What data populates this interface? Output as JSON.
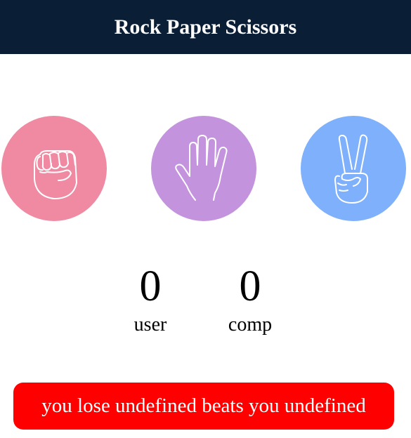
{
  "header": {
    "title": "Rock Paper Scissors"
  },
  "choices": [
    {
      "id": "rock",
      "icon": "fist-icon",
      "color": "#f08aa2"
    },
    {
      "id": "paper",
      "icon": "open-hand-icon",
      "color": "#c493de"
    },
    {
      "id": "scissors",
      "icon": "peace-hand-icon",
      "color": "#7fb0fb"
    }
  ],
  "scores": {
    "user": {
      "value": "0",
      "label": "user"
    },
    "comp": {
      "value": "0",
      "label": "comp"
    }
  },
  "result": {
    "message": "you lose undefined beats you undefined",
    "color": "#ff0000"
  },
  "colors": {
    "header_bg": "#0a1e36"
  }
}
